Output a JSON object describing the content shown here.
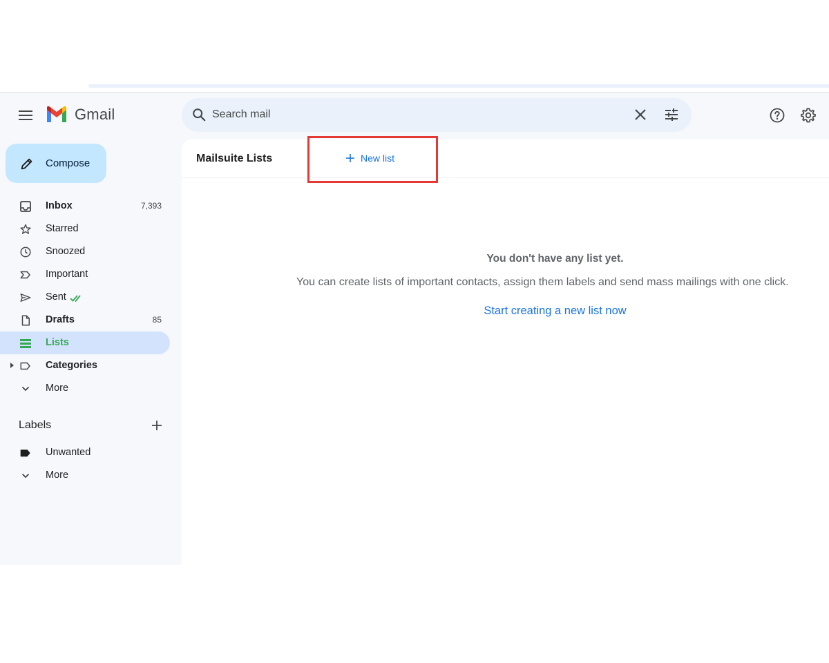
{
  "app": {
    "name": "Gmail"
  },
  "header": {
    "search_placeholder": "Search mail",
    "icons": [
      "menu-icon",
      "gmail-logo",
      "search-icon",
      "close-icon",
      "tune-icon",
      "help-icon",
      "settings-icon"
    ]
  },
  "compose": {
    "label": "Compose"
  },
  "nav": {
    "items": [
      {
        "label": "Inbox",
        "count": "7,393",
        "icon": "inbox-icon"
      },
      {
        "label": "Starred",
        "count": "",
        "icon": "star-icon"
      },
      {
        "label": "Snoozed",
        "count": "",
        "icon": "clock-icon"
      },
      {
        "label": "Important",
        "count": "",
        "icon": "important-icon"
      },
      {
        "label": "Sent",
        "count": "",
        "icon": "send-icon"
      },
      {
        "label": "Drafts",
        "count": "85",
        "icon": "draft-icon"
      },
      {
        "label": "Lists",
        "count": "",
        "icon": "list-icon"
      },
      {
        "label": "Categories",
        "count": "",
        "icon": "label-icon"
      },
      {
        "label": "More",
        "count": "",
        "icon": "chevron-down-icon"
      }
    ]
  },
  "labels": {
    "heading": "Labels",
    "items": [
      {
        "label": "Unwanted",
        "icon": "label-filled-icon"
      },
      {
        "label": "More",
        "icon": "chevron-down-icon"
      }
    ]
  },
  "main": {
    "title": "Mailsuite Lists",
    "new_list_label": "New list",
    "empty_title": "You don't have any list yet.",
    "empty_description": "You can create lists of important contacts, assign them labels and send mass mailings with one click.",
    "empty_link": "Start creating a new list now"
  },
  "colors": {
    "accent": "#1a73e8",
    "active_nav": "#d3e3fd",
    "lists_green": "#34a853",
    "compose_bg": "#c2e7ff",
    "highlight": "#e53935"
  }
}
